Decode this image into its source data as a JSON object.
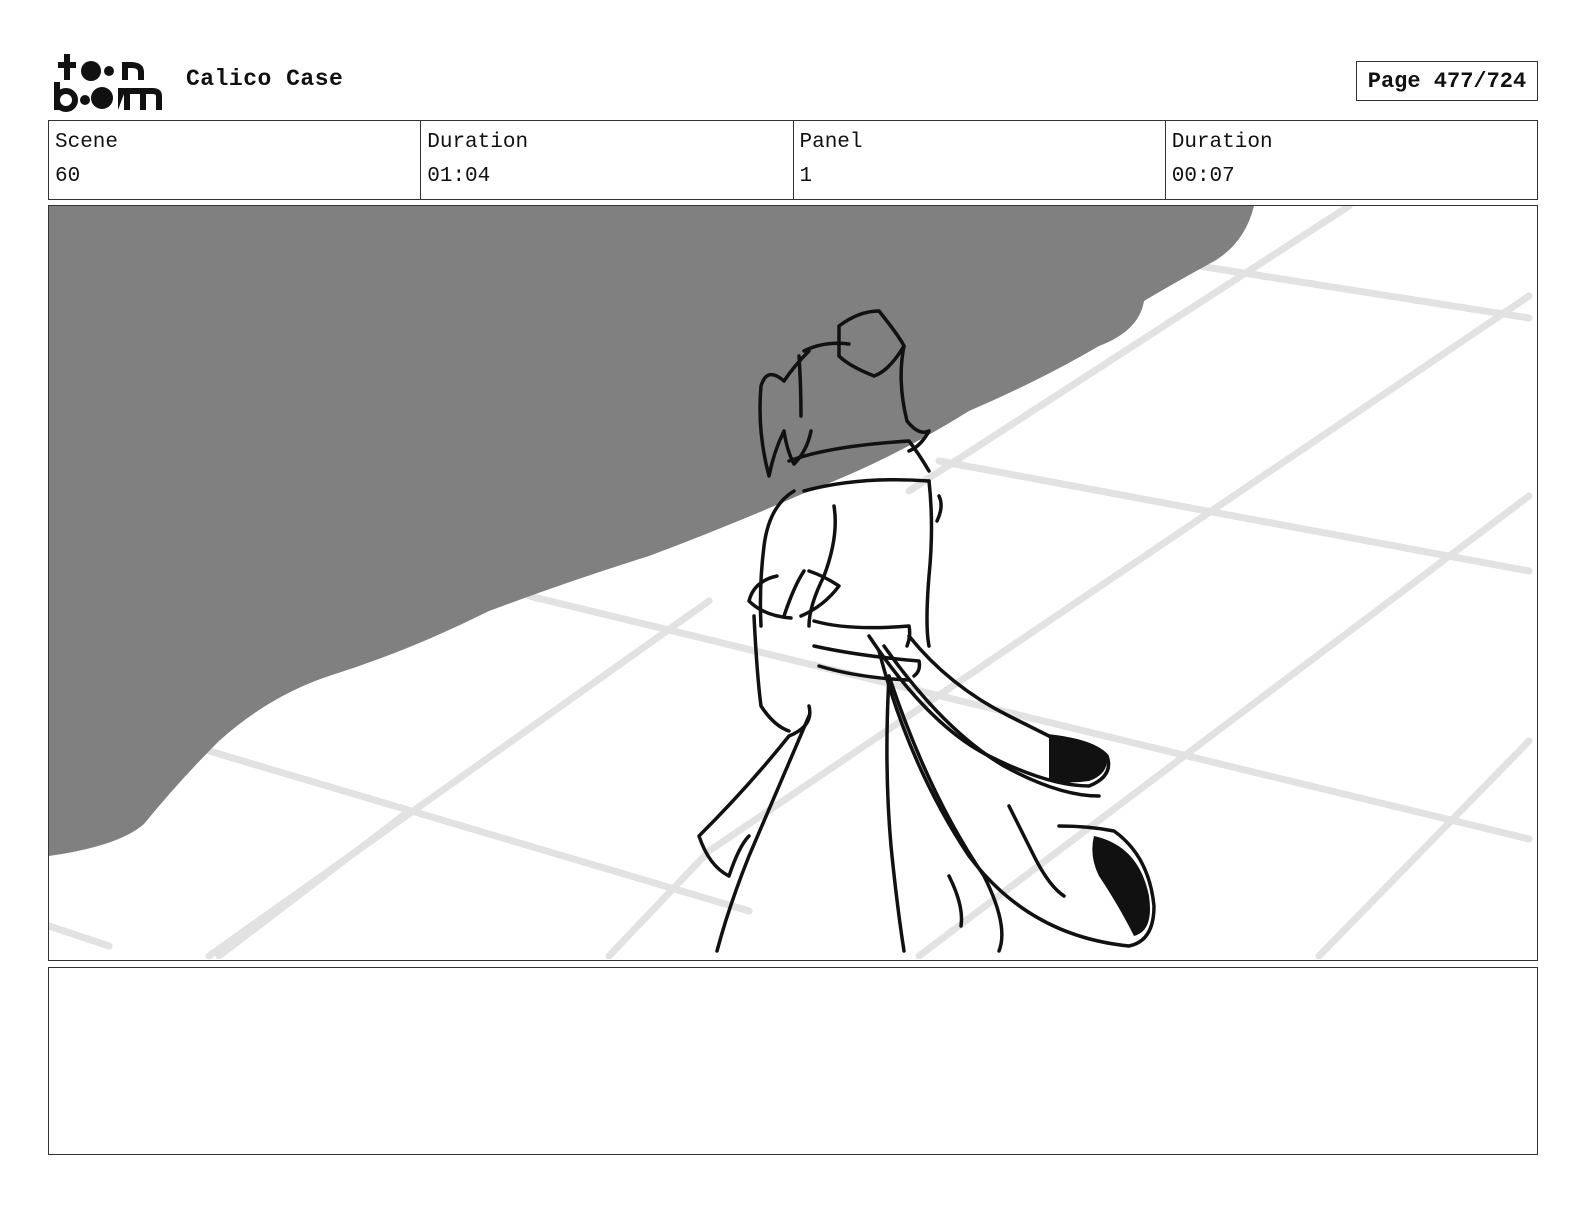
{
  "header": {
    "logo_text": "toon boom",
    "project_title": "Calico Case",
    "page_label": "Page 477/724"
  },
  "info": {
    "scene_label": "Scene",
    "scene_value": "60",
    "scene_duration_label": "Duration",
    "scene_duration_value": "01:04",
    "panel_label": "Panel",
    "panel_value": "1",
    "panel_duration_label": "Duration",
    "panel_duration_value": "00:07"
  },
  "panel": {
    "icon": "storyboard-sketch",
    "colors": {
      "shadow": "#808080",
      "grid": "#e2e2e2",
      "ink": "#111111"
    }
  },
  "notes": {
    "text": ""
  }
}
